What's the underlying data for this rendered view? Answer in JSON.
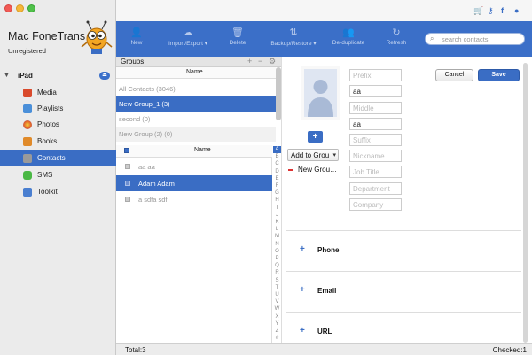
{
  "app": {
    "title": "Mac FoneTrans",
    "subtitle": "Unregistered"
  },
  "sidebar": {
    "device": "iPad",
    "items": [
      {
        "label": "Media",
        "icon": "media-icon",
        "color": "#d94a2c"
      },
      {
        "label": "Playlists",
        "icon": "playlists-icon",
        "color": "#4a8fd9"
      },
      {
        "label": "Photos",
        "icon": "photos-icon",
        "color": "#e0a53a"
      },
      {
        "label": "Books",
        "icon": "books-icon",
        "color": "#e08a2a"
      },
      {
        "label": "Contacts",
        "icon": "contacts-icon",
        "color": "#8a8a8a"
      },
      {
        "label": "SMS",
        "icon": "sms-icon",
        "color": "#4ab844"
      },
      {
        "label": "Toolkit",
        "icon": "toolkit-icon",
        "color": "#4a7fd0"
      }
    ],
    "active": "Contacts"
  },
  "toolbar": {
    "new": "New",
    "import_export": "Import/Export",
    "delete": "Delete",
    "backup_restore": "Backup/Restore",
    "deduplicate": "De-duplicate",
    "refresh": "Refresh",
    "search_placeholder": "search contacts"
  },
  "groups": {
    "title": "Groups",
    "column": "Name",
    "rows": [
      "All Contacts  (3046)",
      "New Group_1  (3)",
      "second  (0)",
      "New Group (2)  (0)"
    ],
    "selected_index": 1
  },
  "contacts": {
    "column": "Name",
    "rows": [
      "aa aa",
      "Adam Adam",
      "a sdfa sdf"
    ],
    "selected_index": 1
  },
  "alphabet": [
    "A",
    "B",
    "C",
    "D",
    "E",
    "F",
    "G",
    "H",
    "I",
    "J",
    "K",
    "L",
    "M",
    "N",
    "O",
    "P",
    "Q",
    "R",
    "S",
    "T",
    "U",
    "V",
    "W",
    "X",
    "Y",
    "Z",
    "#"
  ],
  "detail": {
    "cancel": "Cancel",
    "save": "Save",
    "add_photo": "+",
    "add_to_group": "Add to Grou",
    "group_tag": "New Grou…",
    "fields": [
      {
        "placeholder": "Prefix",
        "value": ""
      },
      {
        "placeholder": "",
        "value": "aa"
      },
      {
        "placeholder": "Middle",
        "value": ""
      },
      {
        "placeholder": "",
        "value": "aa"
      },
      {
        "placeholder": "Suffix",
        "value": ""
      },
      {
        "placeholder": "Nickname",
        "value": ""
      },
      {
        "placeholder": "Job Title",
        "value": ""
      },
      {
        "placeholder": "Department",
        "value": ""
      },
      {
        "placeholder": "Company",
        "value": ""
      }
    ],
    "sections": [
      "Phone",
      "Email",
      "URL"
    ]
  },
  "status": {
    "total": "Total:3",
    "checked": "Checked:1"
  },
  "colors": {
    "accent": "#3a6dc4",
    "toolbar": "#3b6fc8"
  }
}
